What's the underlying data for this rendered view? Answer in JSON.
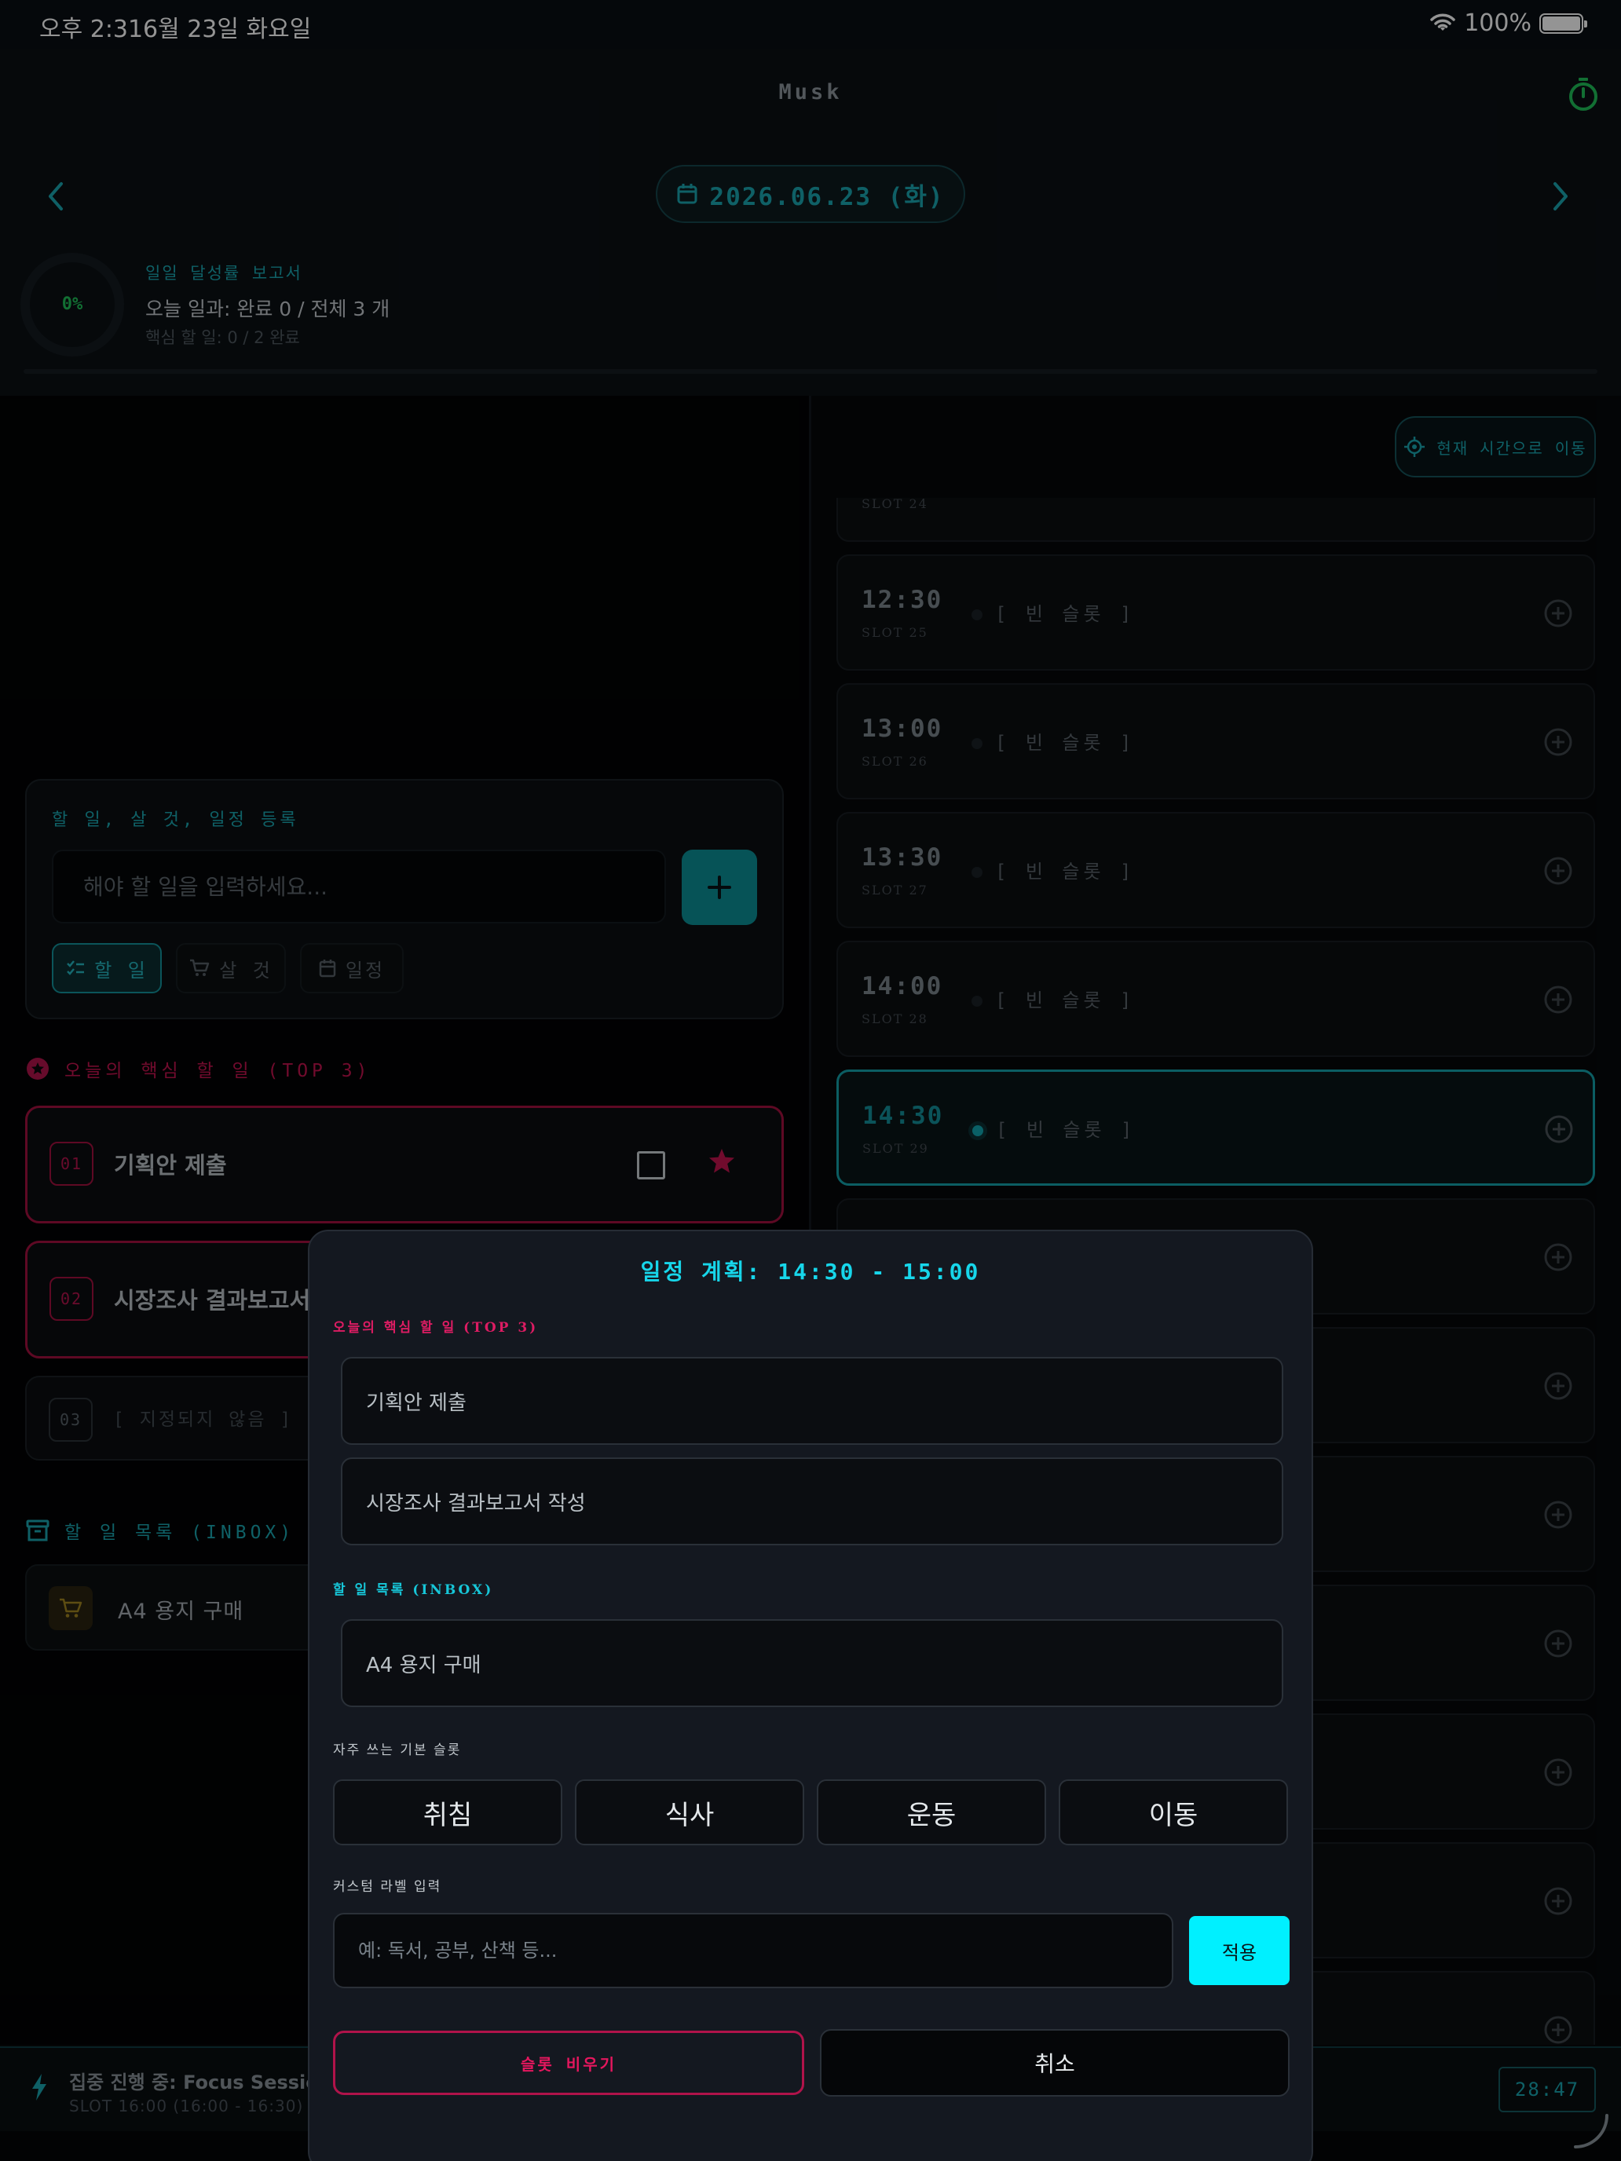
{
  "status_bar": {
    "time": "오후 2:31",
    "date": "6월 23일 화요일",
    "battery": "100%",
    "icons": [
      "wifi-icon",
      "battery-icon"
    ]
  },
  "header": {
    "title": "Musk",
    "date": "2026.06.23 (화)",
    "icons": [
      "timer-icon",
      "chevron-left-icon",
      "chevron-right-icon",
      "calendar-icon"
    ]
  },
  "report": {
    "percent": "0%",
    "progress": 0,
    "title": "일일 달성률 보고서",
    "line1": "오늘 일과: 완료 0 / 전체 3 개",
    "line2": "핵심 할 일: 0 / 2 완료"
  },
  "add_task": {
    "title": "할 일, 살 것, 일정 등록",
    "placeholder": "해야 할 일을 입력하세요...",
    "types": [
      "할 일",
      "살 것",
      "일정"
    ],
    "selected_type": "할 일"
  },
  "top3": {
    "title": "오늘의 핵심 할 일 (TOP 3)",
    "items": [
      {
        "num": "01",
        "label": "기획안 제출"
      },
      {
        "num": "02",
        "label": "시장조사 결과보고서 작성"
      },
      {
        "num": "03",
        "label": "[ 지정되지 않음 ]"
      }
    ]
  },
  "inbox": {
    "title": "할 일 목록 (INBOX)",
    "items": [
      {
        "label": "A4 용지 구매",
        "icon": "cart-icon"
      }
    ]
  },
  "timeline": {
    "now_button": "현재 시간으로 이동",
    "slots": [
      {
        "time": "",
        "num": "SLOT 24",
        "label": ""
      },
      {
        "time": "12:30",
        "num": "SLOT 25",
        "label": "[ 빈 슬롯 ]"
      },
      {
        "time": "13:00",
        "num": "SLOT 26",
        "label": "[ 빈 슬롯 ]"
      },
      {
        "time": "13:30",
        "num": "SLOT 27",
        "label": "[ 빈 슬롯 ]"
      },
      {
        "time": "14:00",
        "num": "SLOT 28",
        "label": "[ 빈 슬롯 ]"
      },
      {
        "time": "14:30",
        "num": "SLOT 29",
        "label": "[ 빈 슬롯 ]",
        "active": true
      },
      {
        "time": "",
        "num": "",
        "label": ""
      },
      {
        "time": "",
        "num": "",
        "label": ""
      },
      {
        "time": "",
        "num": "",
        "label": ""
      },
      {
        "time": "",
        "num": "",
        "label": ""
      },
      {
        "time": "",
        "num": "",
        "label": ""
      },
      {
        "time": "",
        "num": "",
        "label": ""
      },
      {
        "time": "",
        "num": "",
        "label": ""
      }
    ]
  },
  "focus": {
    "title": "집중 진행 중: Focus Session",
    "subtitle": "SLOT 16:00 (16:00 - 16:30)",
    "timer": "28:47"
  },
  "modal": {
    "title": "일정 계획: 14:30 - 15:00",
    "top3_title": "오늘의 핵심 할 일 (TOP 3)",
    "top3_options": [
      "기획안 제출",
      "시장조사 결과보고서 작성"
    ],
    "inbox_title": "할 일 목록 (INBOX)",
    "inbox_options": [
      "A4 용지 구매"
    ],
    "quick_title": "자주 쓰는 기본 슬롯",
    "quick_slots": [
      "취침",
      "식사",
      "운동",
      "이동"
    ],
    "custom_title": "커스텀 라벨 입력",
    "custom_placeholder": "예: 독서, 공부, 산책 등...",
    "apply": "적용",
    "clear": "슬롯 비우기",
    "cancel": "취소"
  },
  "colors": {
    "accent": "#1aa6b0",
    "cyan_bright": "#00f0ff",
    "top3_red": "#c3134f",
    "progress_green": "#1fbf58"
  }
}
